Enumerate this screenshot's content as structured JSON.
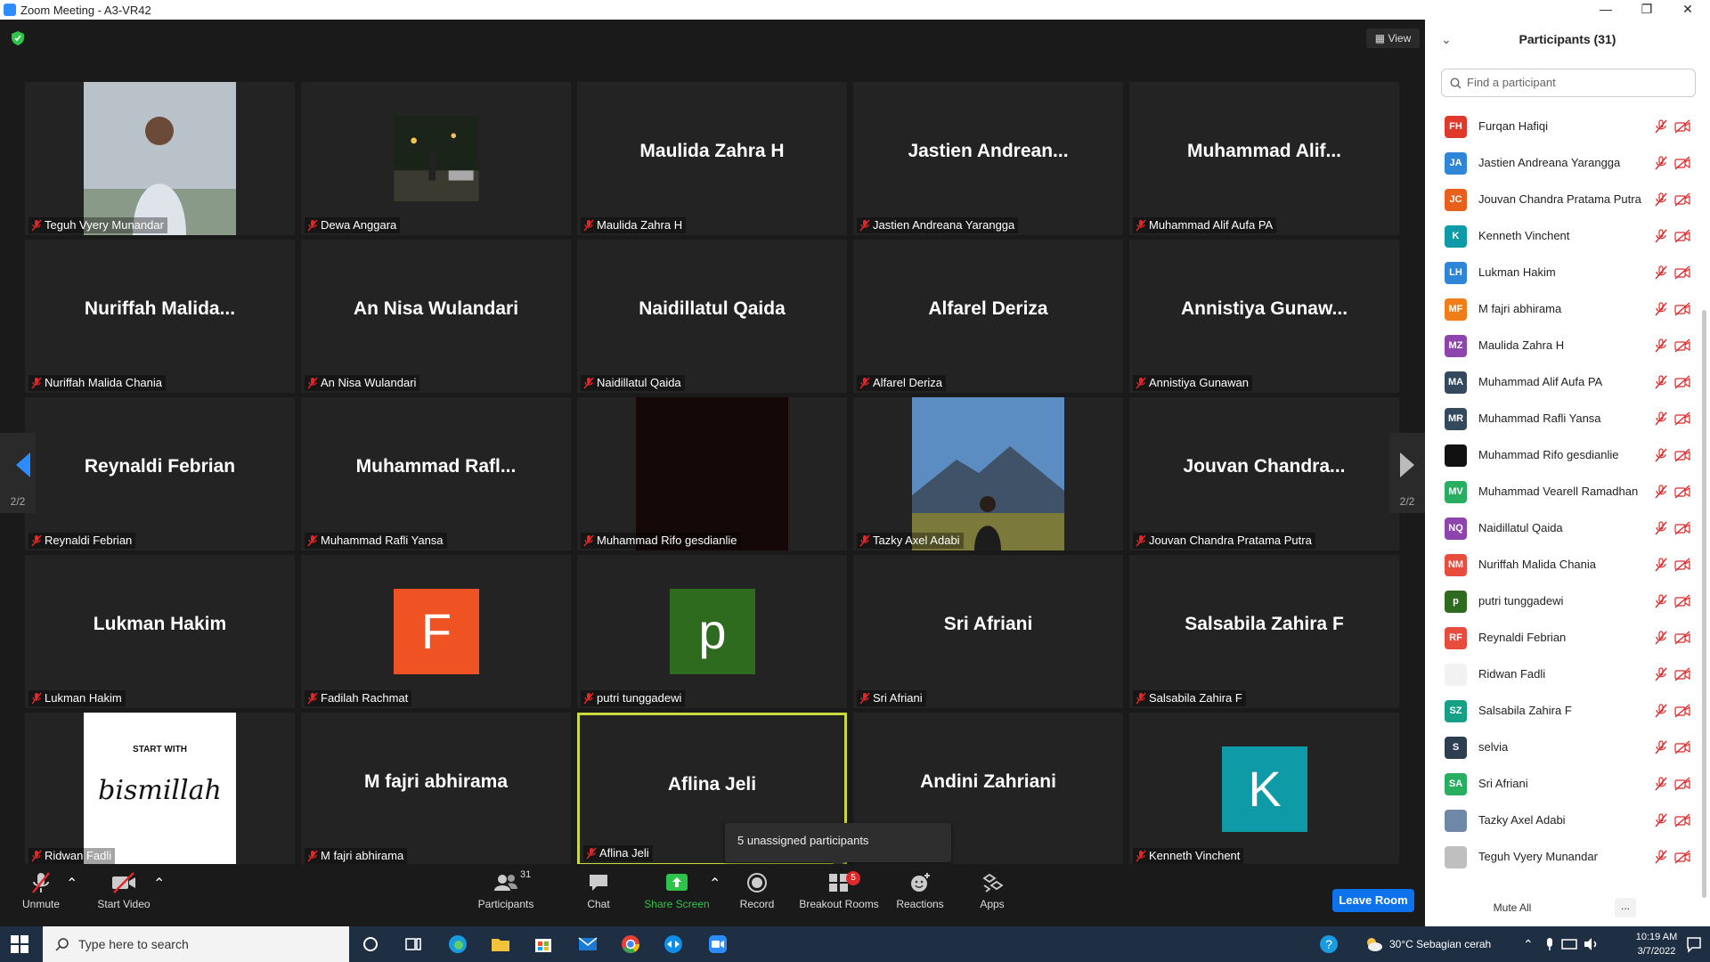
{
  "window": {
    "title": "Zoom Meeting - A3-VR42",
    "minimize": "—",
    "maximize": "❐",
    "close": "✕"
  },
  "meeting": {
    "view_label": "View",
    "page_indicator": "2/2",
    "tooltip": "5 unassigned participants",
    "tiles": [
      {
        "label": "Teguh Vyery Munandar",
        "center": "",
        "kind": "photo-person"
      },
      {
        "label": "Dewa Anggara",
        "center": "",
        "kind": "photo-night"
      },
      {
        "label": "Maulida Zahra H",
        "center": "Maulida Zahra H",
        "kind": "name"
      },
      {
        "label": "Jastien Andreana Yarangga",
        "center": "Jastien  Andrean...",
        "kind": "name"
      },
      {
        "label": "Muhammad Alif Aufa PA",
        "center": "Muhammad  Alif...",
        "kind": "name"
      },
      {
        "label": "Nuriffah Malida Chania",
        "center": "Nuriffah  Malida...",
        "kind": "name"
      },
      {
        "label": "An Nisa Wulandari",
        "center": "An Nisa Wulandari",
        "kind": "name"
      },
      {
        "label": "Naidillatul Qaida",
        "center": "Naidillatul Qaida",
        "kind": "name"
      },
      {
        "label": "Alfarel Deriza",
        "center": "Alfarel Deriza",
        "kind": "name"
      },
      {
        "label": "Annistiya Gunawan",
        "center": "Annistiya  Gunaw...",
        "kind": "name"
      },
      {
        "label": "Reynaldi Febrian",
        "center": "Reynaldi Febrian",
        "kind": "name"
      },
      {
        "label": "Muhammad Rafli Yansa",
        "center": "Muhammad  Rafl...",
        "kind": "name"
      },
      {
        "label": "Muhammad Rifo gesdianlie",
        "center": "",
        "kind": "photo-dark"
      },
      {
        "label": "Tazky Axel Adabi",
        "center": "",
        "kind": "photo-mountain"
      },
      {
        "label": "Jouvan Chandra Pratama Putra",
        "center": "Jouvan  Chandra...",
        "kind": "name"
      },
      {
        "label": "Lukman Hakim",
        "center": "Lukman Hakim",
        "kind": "name"
      },
      {
        "label": "Fadilah Rachmat",
        "center": "",
        "kind": "avatar",
        "letter": "F",
        "color": "#f05323"
      },
      {
        "label": "putri tunggadewi",
        "center": "",
        "kind": "avatar",
        "letter": "p",
        "color": "#2e6b1e"
      },
      {
        "label": "Sri Afriani",
        "center": "Sri Afriani",
        "kind": "name"
      },
      {
        "label": "Salsabila Zahira F",
        "center": "Salsabila Zahira F",
        "kind": "name"
      },
      {
        "label": "Ridwan Fadli",
        "center": "",
        "kind": "photo-bismillah",
        "text_top": "START WITH",
        "text_script": "bismillah"
      },
      {
        "label": "M fajri abhirama",
        "center": "M fajri abhirama",
        "kind": "name"
      },
      {
        "label": "Aflina Jeli",
        "center": "Aflina Jeli",
        "kind": "name",
        "active": true
      },
      {
        "label": "Andini Zahriani",
        "center": "Andini Zahriani",
        "kind": "name",
        "nolabel": true
      },
      {
        "label": "Kenneth Vinchent",
        "center": "",
        "kind": "avatar",
        "letter": "K",
        "color": "#0e9aa7"
      }
    ]
  },
  "toolbar": {
    "unmute": "Unmute",
    "start_video": "Start Video",
    "participants": "Participants",
    "participants_count": "31",
    "chat": "Chat",
    "share_screen": "Share Screen",
    "record": "Record",
    "breakout_rooms": "Breakout Rooms",
    "breakout_badge": "5",
    "reactions": "Reactions",
    "apps": "Apps",
    "leave_room": "Leave Room"
  },
  "panel": {
    "title": "Participants (31)",
    "search_placeholder": "Find a participant",
    "mute_all": "Mute All",
    "more": "...",
    "participants": [
      {
        "initials": "FH",
        "name": "Furqan Hafiqi",
        "color": "#e0392b"
      },
      {
        "initials": "JA",
        "name": "Jastien Andreana Yarangga",
        "color": "#2f86d8"
      },
      {
        "initials": "JC",
        "name": "Jouvan Chandra Pratama Putra",
        "color": "#e8601c"
      },
      {
        "initials": "K",
        "name": "Kenneth Vinchent",
        "color": "#0e9aa7"
      },
      {
        "initials": "LH",
        "name": "Lukman Hakim",
        "color": "#2f86d8"
      },
      {
        "initials": "MF",
        "name": "M fajri abhirama",
        "color": "#f07d1a"
      },
      {
        "initials": "MZ",
        "name": "Maulida Zahra H",
        "color": "#8e44ad"
      },
      {
        "initials": "MA",
        "name": "Muhammad Alif Aufa PA",
        "color": "#34495e"
      },
      {
        "initials": "MR",
        "name": "Muhammad Rafli Yansa",
        "color": "#34495e"
      },
      {
        "initials": "",
        "name": "Muhammad Rifo gesdianlie",
        "color": "#111111"
      },
      {
        "initials": "MV",
        "name": "Muhammad Vearell Ramadhan",
        "color": "#27ae60"
      },
      {
        "initials": "NQ",
        "name": "Naidillatul Qaida",
        "color": "#8e44ad"
      },
      {
        "initials": "NM",
        "name": "Nuriffah Malida Chania",
        "color": "#e74c3c"
      },
      {
        "initials": "p",
        "name": "putri tunggadewi",
        "color": "#2e6b1e"
      },
      {
        "initials": "RF",
        "name": "Reynaldi Febrian",
        "color": "#e74c3c"
      },
      {
        "initials": "",
        "name": "Ridwan Fadli",
        "color": "#f2f2f2"
      },
      {
        "initials": "SZ",
        "name": "Salsabila Zahira F",
        "color": "#16a085"
      },
      {
        "initials": "S",
        "name": "selvia",
        "color": "#2c3e50"
      },
      {
        "initials": "SA",
        "name": "Sri Afriani",
        "color": "#27ae60"
      },
      {
        "initials": "",
        "name": "Tazky Axel Adabi",
        "color": "#6f88a8"
      },
      {
        "initials": "",
        "name": "Teguh Vyery Munandar",
        "color": "#bfbfbf"
      }
    ]
  },
  "taskbar": {
    "search_placeholder": "Type here to search",
    "weather": "30°C  Sebagian cerah",
    "time": "10:19 AM",
    "date": "3/7/2022"
  },
  "colors": {
    "accent": "#0e72ed",
    "active_border": "#c9d93e",
    "muted_red": "#e02828",
    "share_green": "#2ec44a"
  }
}
